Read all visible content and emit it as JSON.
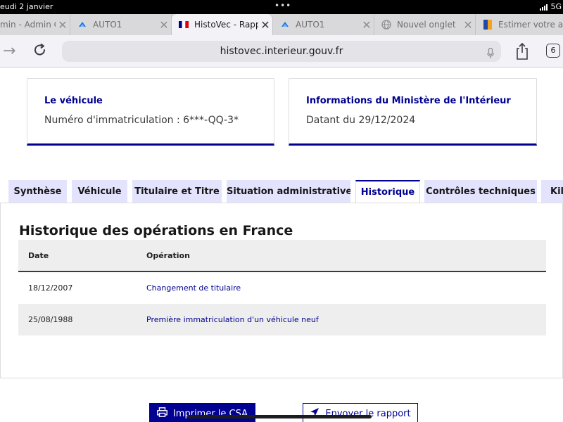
{
  "status_bar": {
    "time": "eudi 2 janvier",
    "network": "5G"
  },
  "browser": {
    "tabs": [
      {
        "title": "min - Admin C",
        "icon": "admin-favicon-icon"
      },
      {
        "title": "AUTO1",
        "icon": "auto1-favicon-icon"
      },
      {
        "title": "HistoVec - Rappo",
        "icon": "french-flag-icon"
      },
      {
        "title": "AUTO1",
        "icon": "auto1-favicon-icon"
      },
      {
        "title": "Nouvel onglet",
        "icon": "globe-icon"
      },
      {
        "title": "Estimer votre au",
        "icon": "estimate-favicon-icon"
      }
    ],
    "url": "histovec.interieur.gouv.fr",
    "tab_count": "6"
  },
  "cards": {
    "vehicle": {
      "title": "Le véhicule",
      "text": "Numéro d'immatriculation : 6***-QQ-3*"
    },
    "ministry": {
      "title": "Informations du Ministère de l'Intérieur",
      "text": "Datant du 29/12/2024"
    }
  },
  "report_tabs": [
    "Synthèse",
    "Véhicule",
    "Titulaire et Titre",
    "Situation administrative",
    "Historique",
    "Contrôles techniques",
    "Kilo"
  ],
  "history": {
    "title": "Historique des opérations en France",
    "columns": [
      "Date",
      "Opération"
    ],
    "rows": [
      {
        "date": "18/12/2007",
        "operation": "Changement de titulaire"
      },
      {
        "date": "25/08/1988",
        "operation": "Première immatriculation d'un véhicule neuf"
      }
    ]
  },
  "actions": {
    "print": "Imprimer le CSA",
    "send": "Envoyer le rapport"
  },
  "colors": {
    "primary": "#000091",
    "tab_background": "#e3e3fd"
  }
}
